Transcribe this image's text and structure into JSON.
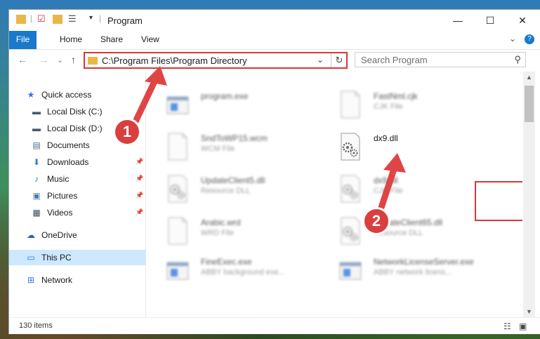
{
  "window": {
    "title": "Program",
    "controls": {
      "minimize": "—",
      "maximize": "☐",
      "close": "✕"
    }
  },
  "ribbon": {
    "tabs": [
      "File",
      "Home",
      "Share",
      "View"
    ],
    "expand": "⌄",
    "help": "?"
  },
  "address": {
    "path": "C:\\Program Files\\Program Directory",
    "dropdown": "⌄",
    "refresh": "↻"
  },
  "search": {
    "placeholder": "Search Program",
    "icon": "⚲"
  },
  "nav": {
    "back": "←",
    "forward": "→",
    "recent": "⌄",
    "up": "↑"
  },
  "sidebar": {
    "items": [
      {
        "label": "Quick access",
        "icon": "★",
        "color": "#2f7ad8",
        "pinned": false
      },
      {
        "label": "Local Disk (C:)",
        "icon": "▬",
        "color": "#4a5a6a",
        "pinned": false
      },
      {
        "label": "Local Disk (D:)",
        "icon": "▬",
        "color": "#4a5a6a",
        "pinned": false
      },
      {
        "label": "Documents",
        "icon": "▤",
        "color": "#4a6a8a",
        "pinned": false
      },
      {
        "label": "Downloads",
        "icon": "⬇",
        "color": "#2f7ad8",
        "pinned": true
      },
      {
        "label": "Music",
        "icon": "♪",
        "color": "#2f7ad8",
        "pinned": true
      },
      {
        "label": "Pictures",
        "icon": "▣",
        "color": "#4a7aa8",
        "pinned": true
      },
      {
        "label": "Videos",
        "icon": "▦",
        "color": "#3a4a5a",
        "pinned": true
      },
      {
        "label": "OneDrive",
        "icon": "☁",
        "color": "#1c64c8",
        "pinned": false
      },
      {
        "label": "This PC",
        "icon": "▭",
        "color": "#3a7ad0",
        "pinned": false
      },
      {
        "label": "Network",
        "icon": "⊞",
        "color": "#2f7ad8",
        "pinned": false
      }
    ]
  },
  "files": [
    {
      "name": "program.exe",
      "type": ""
    },
    {
      "name": "FastNml.cjk",
      "type": "CJK File"
    },
    {
      "name": "SndToWP15.wcm",
      "type": "WCM File"
    },
    {
      "name": "dx9.dll",
      "type": ""
    },
    {
      "name": "UpdateClient5.dll",
      "type": "Resource DLL"
    },
    {
      "name": "dx9.dll",
      "type": "CJK File"
    },
    {
      "name": "Arabic.wrd",
      "type": "WRD File"
    },
    {
      "name": "UpdateClient65.dll",
      "type": "Resource DLL"
    },
    {
      "name": "FineExec.exe",
      "type": "ABBY background exe..."
    },
    {
      "name": "NetworkLicenseServer.exe",
      "type": "ABBY network licens..."
    }
  ],
  "status": {
    "count": "130 items"
  },
  "annotations": {
    "step1": "1",
    "step2": "2"
  },
  "colors": {
    "accent": "#1979ca",
    "highlight": "#d9373a",
    "selected": "#cde8ff"
  }
}
